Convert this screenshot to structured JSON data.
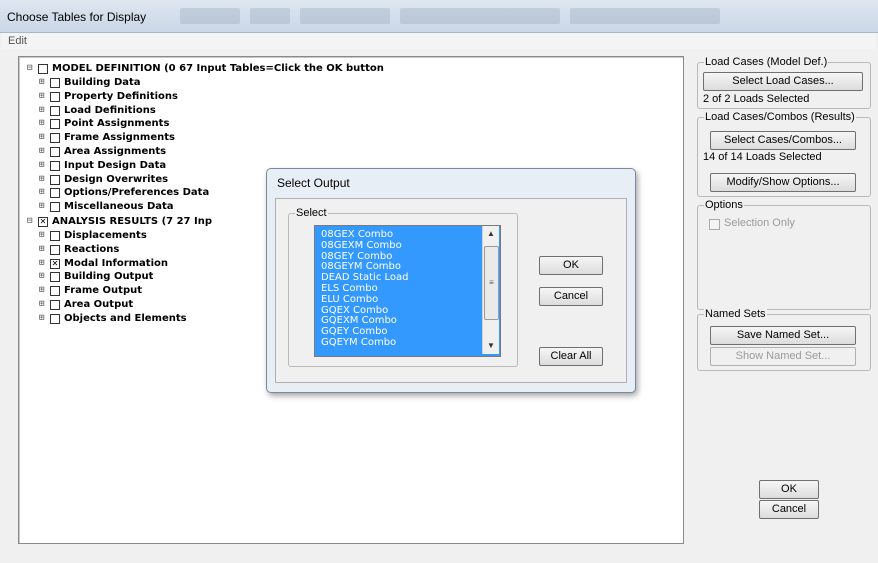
{
  "window": {
    "title": "Choose Tables for Display"
  },
  "menu": {
    "edit": "Edit"
  },
  "tree": {
    "model_definition": "MODEL DEFINITION  (0  67 Input Tables=Click the OK button",
    "model_children": [
      "Building Data",
      "Property Definitions",
      "Load Definitions",
      "Point Assignments",
      "Frame Assignments",
      "Area Assignments",
      "Input Design Data",
      "Design Overwrites",
      "Options/Preferences Data",
      "Miscellaneous Data"
    ],
    "analysis_results": "ANALYSIS RESULTS  (7  27 Inp",
    "analysis_children": [
      "Displacements",
      "Reactions",
      "Modal Information",
      "Building Output",
      "Frame Output",
      "Area Output",
      "Objects and Elements"
    ],
    "checked_child": "Modal Information"
  },
  "load_cases_model": {
    "group": "Load Cases (Model Def.)",
    "button": "Select Load Cases...",
    "status": "2 of 2 Loads Selected"
  },
  "load_cases_results": {
    "group": "Load Cases/Combos (Results)",
    "button": "Select Cases/Combos...",
    "status": "14 of 14 Loads Selected",
    "modify_button": "Modify/Show Options..."
  },
  "options": {
    "group": "Options",
    "selection_only": "Selection Only"
  },
  "named_sets": {
    "group": "Named Sets",
    "save": "Save Named Set...",
    "show": "Show Named Set..."
  },
  "main_buttons": {
    "ok": "OK",
    "cancel": "Cancel"
  },
  "dialog": {
    "title": "Select Output",
    "group": "Select",
    "items": [
      "08GEX Combo",
      "08GEXM Combo",
      "08GEY Combo",
      "08GEYM Combo",
      "DEAD Static Load",
      "ELS Combo",
      "ELU Combo",
      "GQEX Combo",
      "GQEXM Combo",
      "GQEY Combo",
      "GQEYM Combo"
    ],
    "ok": "OK",
    "cancel": "Cancel",
    "clear_all": "Clear All"
  },
  "colors": {
    "selection": "#3399ff",
    "titlebar": "#c9d6e6"
  },
  "icons": [
    "expand-plus-icon",
    "checkbox-icon",
    "checked-box-icon",
    "scroll-up-icon",
    "scroll-down-icon"
  ]
}
